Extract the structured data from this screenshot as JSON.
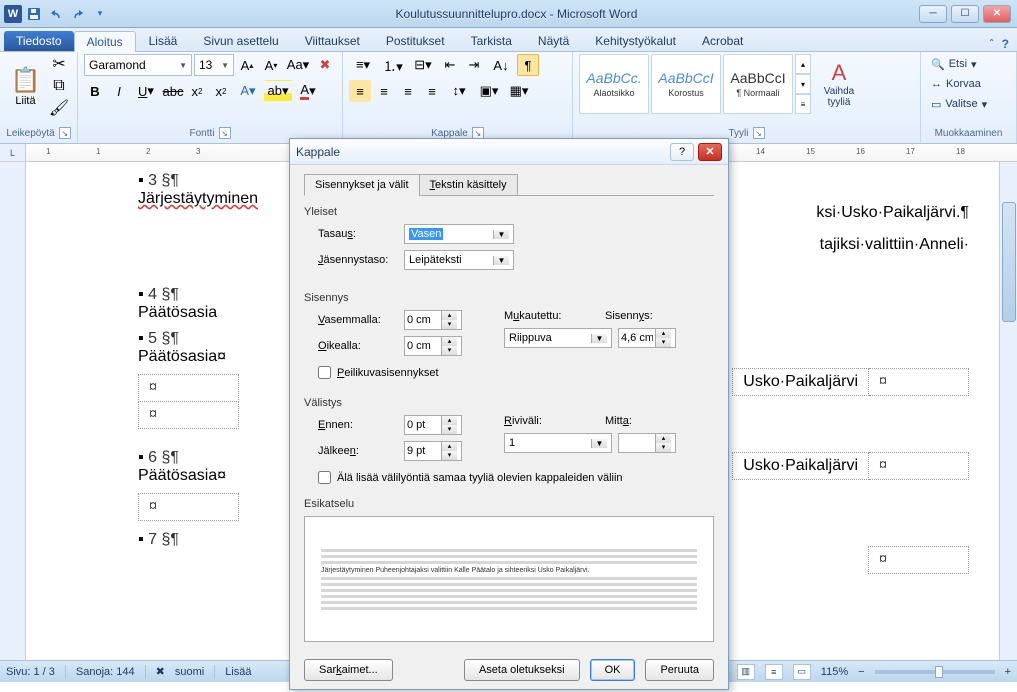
{
  "window": {
    "title": "Koulutussuunnittelupro.docx - Microsoft Word"
  },
  "tabs": {
    "file": "Tiedosto",
    "home": "Aloitus",
    "insert": "Lisää",
    "layout": "Sivun asettelu",
    "references": "Viittaukset",
    "mailings": "Postitukset",
    "review": "Tarkista",
    "view": "Näytä",
    "developer": "Kehitystyökalut",
    "acrobat": "Acrobat"
  },
  "clipboard": {
    "paste": "Liitä",
    "group": "Leikepöytä"
  },
  "font": {
    "group": "Fontti",
    "name": "Garamond",
    "size": "13"
  },
  "paragraph": {
    "group": "Kappale"
  },
  "styles": {
    "group": "Tyyli",
    "change": "Vaihda tyyliä",
    "items": [
      {
        "preview": "AaBbCc.",
        "name": "Alaotsikko"
      },
      {
        "preview": "AaBbCcI",
        "name": "Korostus"
      },
      {
        "preview": "AaBbCcI",
        "name": "¶ Normaali"
      }
    ]
  },
  "editing": {
    "group": "Muokkaaminen",
    "find": "Etsi",
    "replace": "Korvaa",
    "select": "Valitse"
  },
  "document": {
    "sec3_num": "3 §¶",
    "sec3_title": "Järjestäytyminen",
    "sec4_num": "4 §¶",
    "sec4_title": "Päätösasia",
    "sec5_num": "5 §¶",
    "sec5_title": "Päätösasia¤",
    "sec6_num": "6 §¶",
    "sec6_title": "Päätösasia¤",
    "sec7_num": "7 §¶",
    "right_line1_a": "ksi·Usko·",
    "right_line1_b": "Paikaljärvi",
    "right_line1_c": ".¶",
    "right_line2": "tajiksi·valittiin·Anneli·",
    "cell_r1": "Usko·",
    "cell_r1b": "Paikaljärvi",
    "cell_r2": "Usko·",
    "cell_r2b": "Paikaljärvi",
    "currency": "¤"
  },
  "status": {
    "page": "Sivu: 1 / 3",
    "words": "Sanoja: 144",
    "lang": "suomi",
    "insert": "Lisää",
    "zoom": "115%"
  },
  "dialog": {
    "title": "Kappale",
    "tab1": "Sisennykset ja välit",
    "tab2": "Tekstin käsittely",
    "sec_general": "Yleiset",
    "align_lbl": "Tasaus:",
    "align_val": "Vasen",
    "outline_lbl": "Jäsennystaso:",
    "outline_val": "Leipäteksti",
    "sec_indent": "Sisennys",
    "left_lbl": "Vasemmalla:",
    "left_val": "0 cm",
    "right_lbl": "Oikealla:",
    "right_val": "0 cm",
    "special_lbl": "Mukautettu:",
    "special_val": "Riippuva",
    "by_lbl": "Sisennys:",
    "by_val": "4,6 cm",
    "mirror_lbl": "Peilikuvasisennykset",
    "sec_spacing": "Välistys",
    "before_lbl": "Ennen:",
    "before_val": "0 pt",
    "after_lbl": "Jälkeen:",
    "after_val": "9 pt",
    "linesp_lbl": "Riviväli:",
    "linesp_val": "1",
    "at_lbl": "Mitta:",
    "at_val": "",
    "nospace_lbl": "Älä lisää välilyöntiä samaa tyyliä olevien kappaleiden väliin",
    "sec_preview": "Esikatselu",
    "preview_sample": "Järjestäytyminen          Puheenjohtajaksi valittiin Kalle Päätalo ja sihteeriksi Usko Paikaljärvi.",
    "btn_tabs": "Sarkaimet...",
    "btn_default": "Aseta oletukseksi",
    "btn_ok": "OK",
    "btn_cancel": "Peruuta"
  }
}
